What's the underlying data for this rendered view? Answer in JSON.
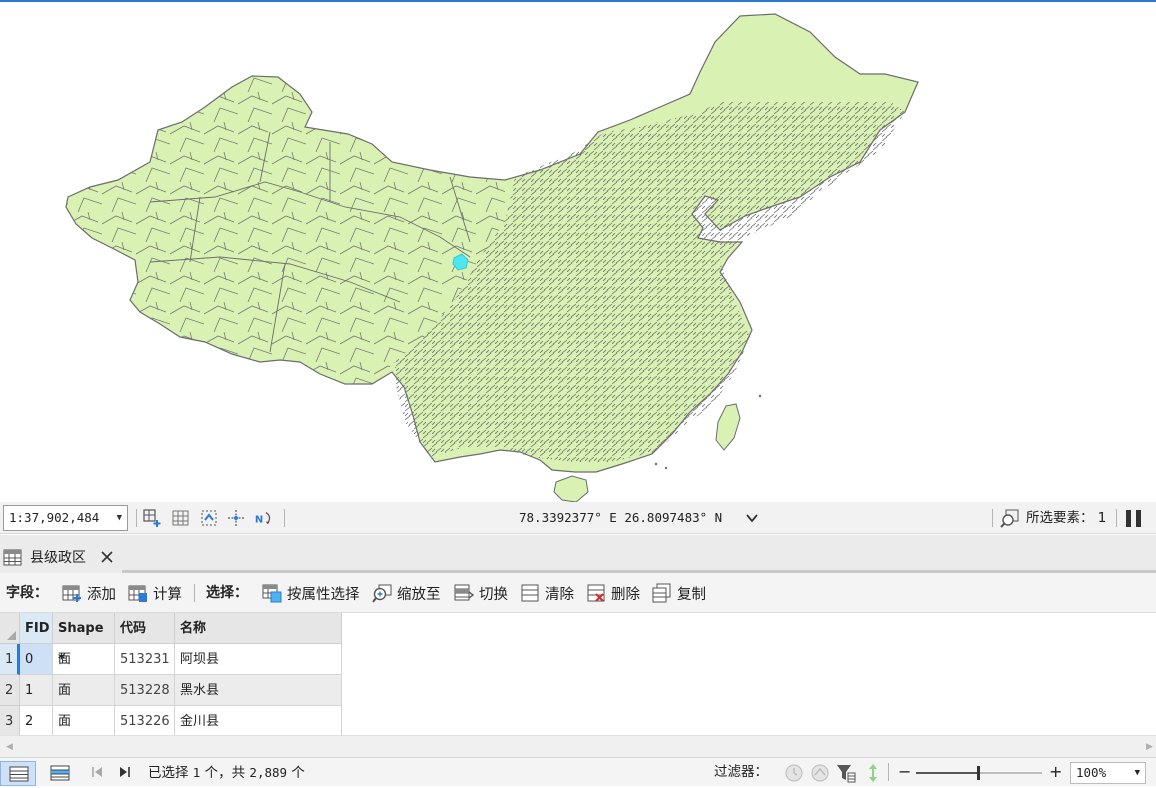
{
  "colors": {
    "land": "#d9f2b4",
    "boundary": "#6c6c6c",
    "selected": "#4fe6f0",
    "accent": "#2b7bd6"
  },
  "map": {
    "region": "china-counties",
    "selection_marker": "selected-county"
  },
  "mapbar": {
    "scale": "1:37,902,484",
    "coordinates": "78.3392377° E 26.8097483° N",
    "selected_features_label": "所选要素：",
    "selected_features_count": "1"
  },
  "table_tab": {
    "title": "县级政区"
  },
  "toolbar": {
    "fields_label": "字段：",
    "add_label": "添加",
    "calculate_label": "计算",
    "selection_label": "选择：",
    "select_by_attributes_label": "按属性选择",
    "zoom_to_label": "缩放至",
    "switch_label": "切换",
    "clear_label": "清除",
    "delete_label": "删除",
    "copy_label": "复制"
  },
  "table": {
    "columns": [
      "FID",
      "Shape *",
      "代码",
      "名称"
    ],
    "rows": [
      {
        "row_num": "1",
        "fid": "0",
        "shape": "面",
        "code": "513231",
        "name": "阿坝县",
        "selected": true
      },
      {
        "row_num": "2",
        "fid": "1",
        "shape": "面",
        "code": "513228",
        "name": "黑水县",
        "selected": false
      },
      {
        "row_num": "3",
        "fid": "2",
        "shape": "面",
        "code": "513226",
        "name": "金川县",
        "selected": false
      }
    ]
  },
  "statusbar": {
    "selection_prefix": "已选择",
    "selection_count": "1",
    "selection_middle": "个，共",
    "total_count": "2,889",
    "selection_suffix": "个",
    "filter_label": "过滤器：",
    "zoom_value": "100%"
  }
}
